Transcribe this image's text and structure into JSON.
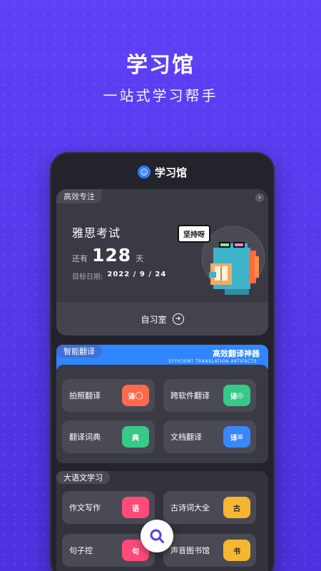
{
  "hero": {
    "title": "学习馆",
    "subtitle": "一站式学习帮手"
  },
  "app": {
    "title": "学习馆",
    "logo_icon": "smile-icon"
  },
  "focus": {
    "tag": "高效专注",
    "exam_name": "雅思考试",
    "remain_prefix": "还有",
    "days": "128",
    "days_unit": "天",
    "target_label": "目标日期:",
    "target_date": "2022 / 9 / 24",
    "mascot_bubble": "坚持呀",
    "study_room": "自习室"
  },
  "translate": {
    "tag": "智能翻译",
    "banner_title": "高效翻译神器",
    "banner_en": "EFFICIENT TRANSLATION ARTIFACTS",
    "items": [
      {
        "label": "拍照翻译",
        "badge": "译",
        "color": "#ff6a4a"
      },
      {
        "label": "跨软件翻译",
        "badge": "译",
        "color": "#36c98a"
      },
      {
        "label": "翻译词典",
        "badge": "典",
        "color": "#36c98a"
      },
      {
        "label": "文档翻译",
        "badge": "译",
        "color": "#3a86ff"
      }
    ]
  },
  "literature": {
    "tag": "大语文学习",
    "items": [
      {
        "label": "作文写作",
        "badge": "语",
        "color": "#ff4a7a"
      },
      {
        "label": "古诗词大全",
        "badge": "古",
        "color": "#f5b731"
      },
      {
        "label": "句子控",
        "badge": "句",
        "color": "#ff4a7a"
      },
      {
        "label": "声音图书馆",
        "badge": "书",
        "color": "#f5b731"
      }
    ]
  },
  "colors": {
    "background": "#5b3cf0",
    "card": "#3a3a44",
    "accent_blue": "#2f86ff"
  }
}
